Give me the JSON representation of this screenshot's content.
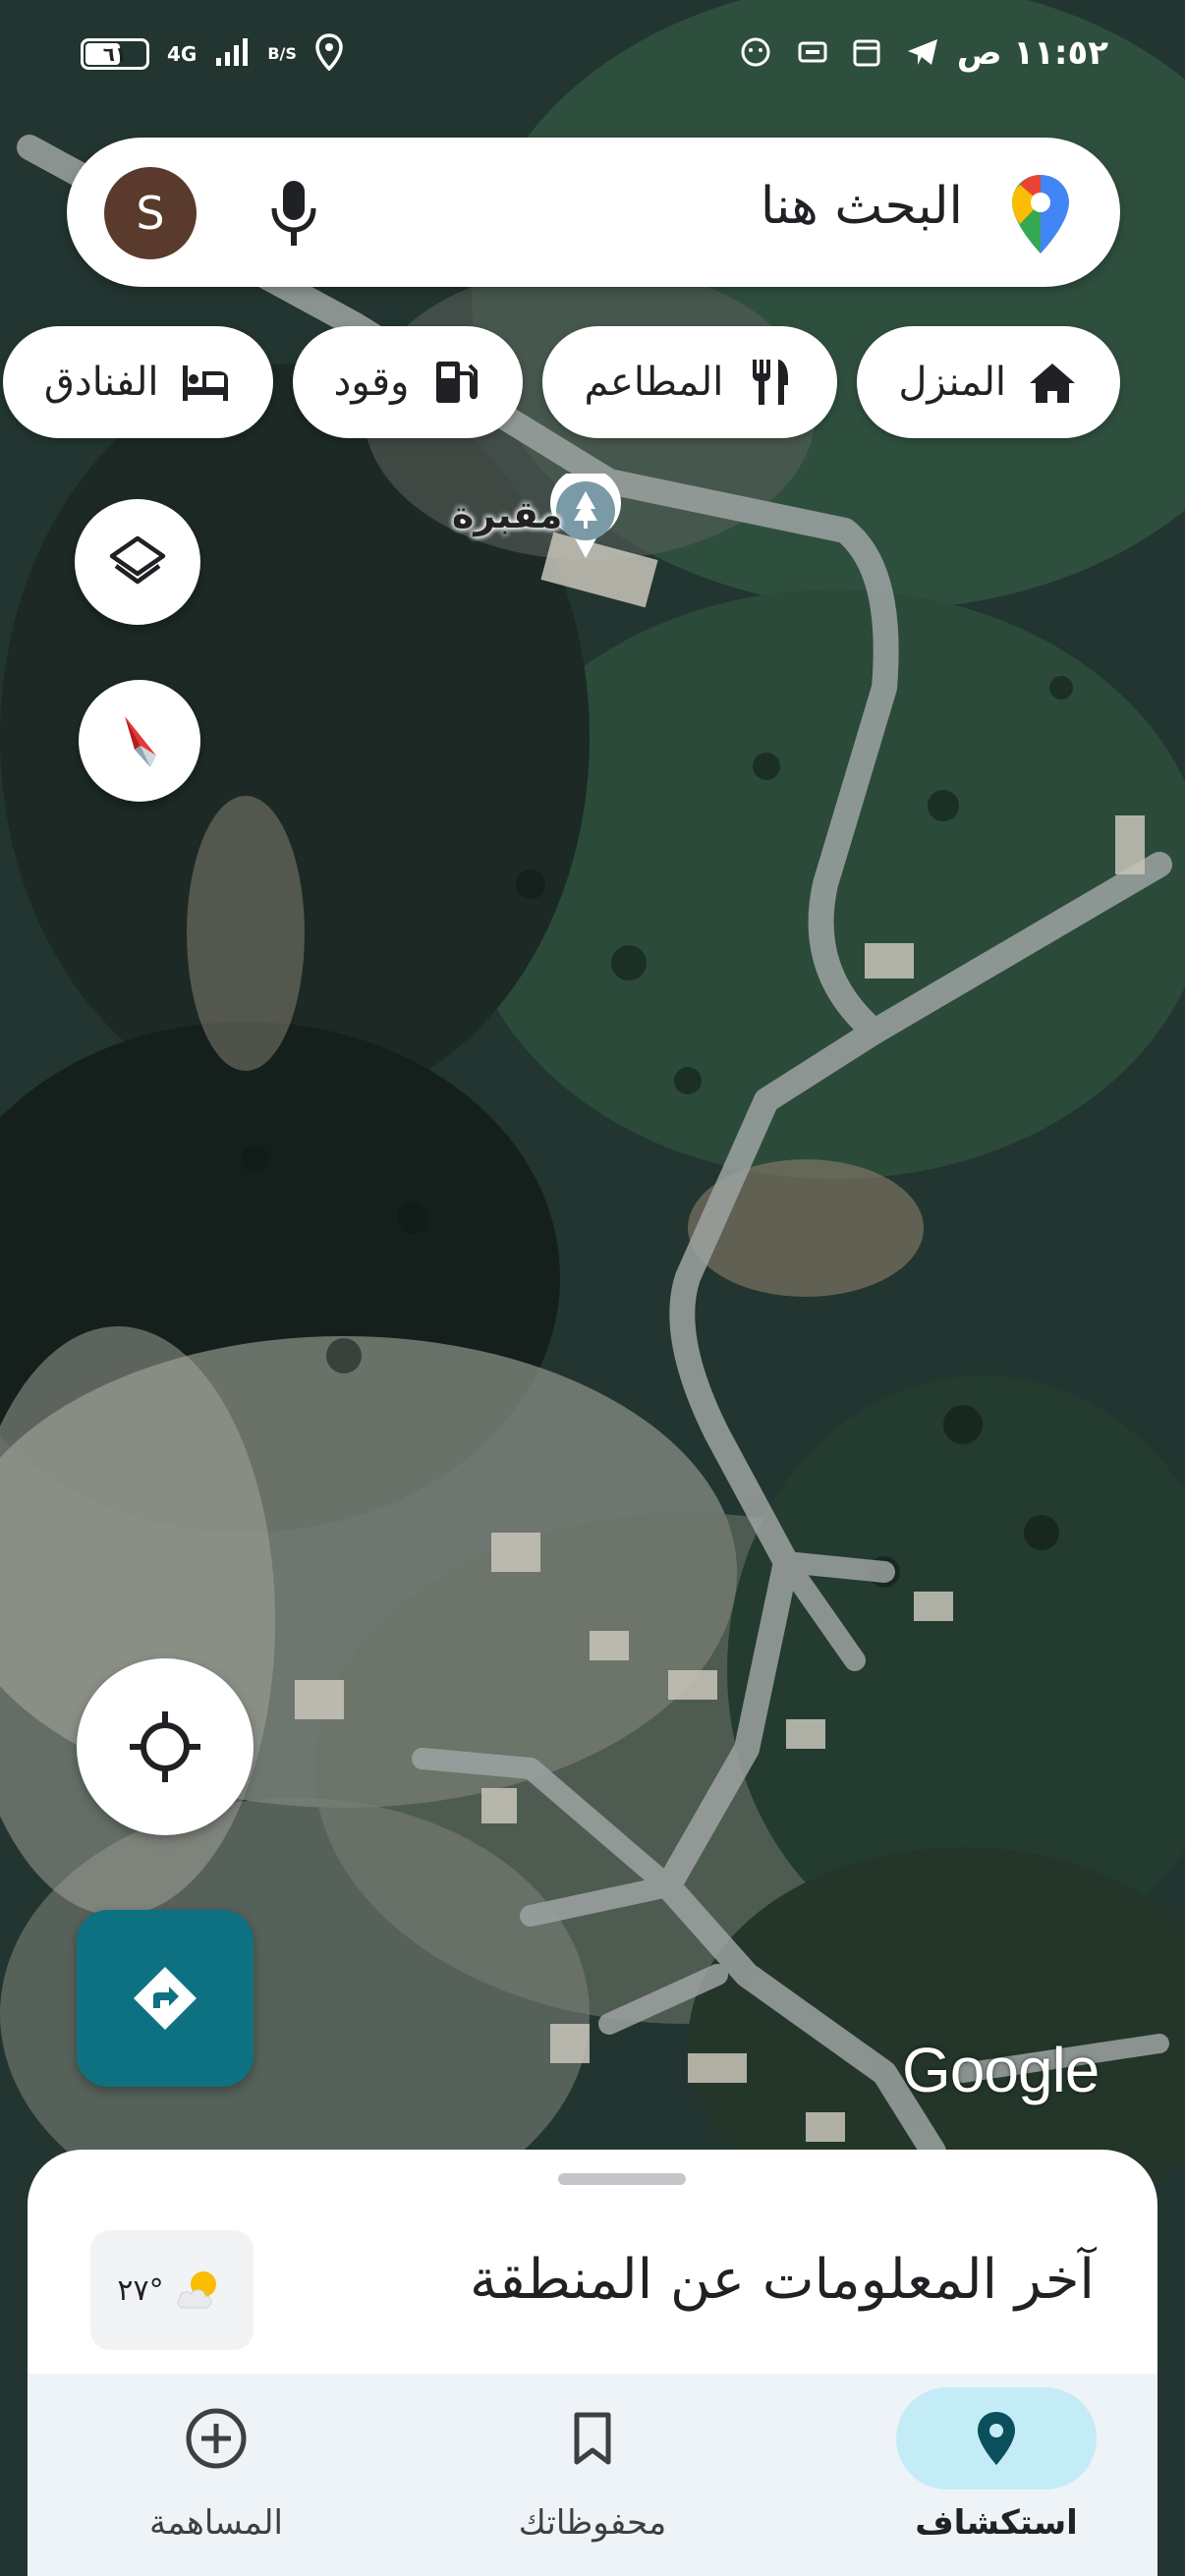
{
  "status_bar": {
    "time": "١١:٥٢ ص",
    "battery": "٦١",
    "battery_level": 0.61,
    "network": "4G",
    "speed": "B/S"
  },
  "search": {
    "placeholder": "البحث هنا",
    "avatar_letter": "S"
  },
  "chips": [
    {
      "label": "المنزل",
      "icon": "home-icon"
    },
    {
      "label": "المطاعم",
      "icon": "restaurant-icon"
    },
    {
      "label": "وقود",
      "icon": "fuel-icon"
    },
    {
      "label": "الفنادق",
      "icon": "hotel-icon"
    }
  ],
  "map": {
    "poi_label": "مقبرة",
    "attribution": "Google"
  },
  "sheet": {
    "title": "آخر المعلومات عن المنطقة",
    "temperature": "٢٧°"
  },
  "bottom_nav": [
    {
      "label": "استكشاف",
      "icon": "explore-pin-icon",
      "active": true
    },
    {
      "label": "محفوظاتك",
      "icon": "bookmark-icon",
      "active": false
    },
    {
      "label": "المساهمة",
      "icon": "add-circle-icon",
      "active": false
    }
  ],
  "colors": {
    "accent": "#0e7181",
    "active_pill": "#c3ecf6",
    "sheet_bg": "#ffffff",
    "nav_bg": "#eef3f8"
  }
}
